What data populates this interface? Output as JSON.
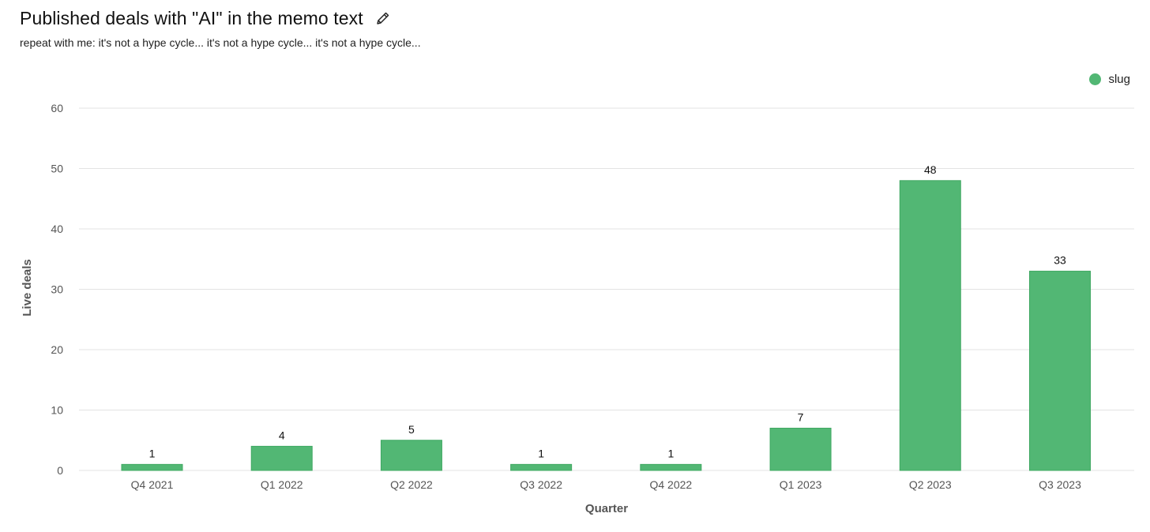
{
  "header": {
    "title": "Published deals with \"AI\" in the memo text",
    "subtitle": "repeat with me: it's not a hype cycle... it's not a hype cycle... it's not a hype cycle...",
    "edit_icon": "pencil-icon"
  },
  "legend": {
    "label": "slug",
    "placement": "top-right"
  },
  "colors": {
    "bar": "#52b774",
    "bar_stroke": "#3fa862",
    "grid": "#e3e3e3",
    "axis_text": "#555555",
    "value_text": "#111111"
  },
  "chart_data": {
    "type": "bar",
    "title": "Published deals with \"AI\" in the memo text",
    "subtitle": "repeat with me: it's not a hype cycle... it's not a hype cycle... it's not a hype cycle...",
    "xlabel": "Quarter",
    "ylabel": "Live deals",
    "ylim": [
      0,
      60
    ],
    "yticks": [
      0,
      10,
      20,
      30,
      40,
      50,
      60
    ],
    "grid": true,
    "categories": [
      "Q4 2021",
      "Q1 2022",
      "Q2 2022",
      "Q3 2022",
      "Q4 2022",
      "Q1 2023",
      "Q2 2023",
      "Q3 2023"
    ],
    "series": [
      {
        "name": "slug",
        "values": [
          1,
          4,
          5,
          1,
          1,
          7,
          48,
          33
        ]
      }
    ],
    "data_labels": true
  }
}
